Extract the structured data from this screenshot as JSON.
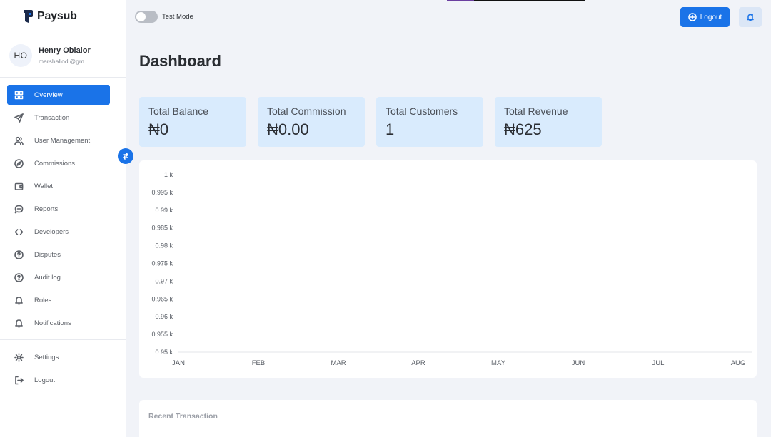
{
  "brand": {
    "name": "Paysub"
  },
  "user": {
    "initials": "HO",
    "name": "Henry Obialor",
    "email": "marshallodi@gm..."
  },
  "nav": [
    {
      "label": "Overview",
      "icon": "grid-icon",
      "active": true
    },
    {
      "label": "Transaction",
      "icon": "send-icon"
    },
    {
      "label": "User Management",
      "icon": "users-icon"
    },
    {
      "label": "Commissions",
      "icon": "compass-icon"
    },
    {
      "label": "Wallet",
      "icon": "wallet-icon"
    },
    {
      "label": "Reports",
      "icon": "chat-icon"
    },
    {
      "label": "Developers",
      "icon": "code-icon"
    },
    {
      "label": "Disputes",
      "icon": "help-circle-icon"
    },
    {
      "label": "Audit log",
      "icon": "help-circle-icon"
    },
    {
      "label": "Roles",
      "icon": "bell-icon"
    },
    {
      "label": "Notifications",
      "icon": "bell-icon"
    }
  ],
  "nav_bottom": [
    {
      "label": "Settings",
      "icon": "gear-icon"
    },
    {
      "label": "Logout",
      "icon": "logout-icon"
    }
  ],
  "topbar": {
    "test_mode_label": "Test Mode",
    "test_mode_on": false,
    "logout_label": "Logout"
  },
  "page": {
    "title": "Dashboard"
  },
  "stats": [
    {
      "label": "Total Balance",
      "value": "₦0"
    },
    {
      "label": "Total Commission",
      "value": "₦0.00"
    },
    {
      "label": "Total Customers",
      "value": "1"
    },
    {
      "label": "Total Revenue",
      "value": "₦625"
    }
  ],
  "chart_data": {
    "type": "line",
    "categories": [
      "JAN",
      "FEB",
      "MAR",
      "APR",
      "MAY",
      "JUN",
      "JUL",
      "AUG"
    ],
    "y_ticks": [
      "1 k",
      "0.995 k",
      "0.99 k",
      "0.985 k",
      "0.98 k",
      "0.975 k",
      "0.97 k",
      "0.965 k",
      "0.96 k",
      "0.955 k",
      "0.95 k"
    ],
    "series": [],
    "ylim": [
      950,
      1000
    ],
    "grid": false
  },
  "recent": {
    "title": "Recent Transaction"
  },
  "colors": {
    "accent": "#1a73e8",
    "stat_bg": "#d9ebfd",
    "page_bg": "#f1f3f8"
  }
}
